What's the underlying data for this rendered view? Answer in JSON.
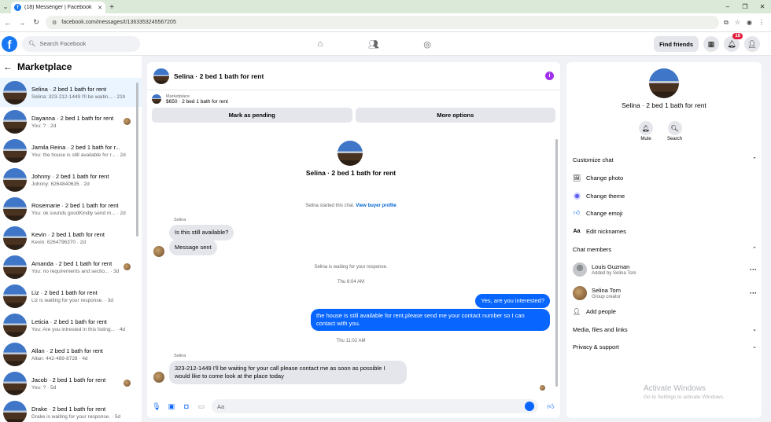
{
  "browser": {
    "tab_title": "(18) Messenger | Facebook",
    "url": "facebook.com/messages/t/1363353245567205"
  },
  "fb": {
    "search_placeholder": "Search Facebook",
    "find_friends": "Find friends",
    "notifications_badge": "18"
  },
  "sidebar": {
    "title": "Marketplace",
    "conversations": [
      {
        "title": "Selina · 2 bed 1 bath for rent",
        "sub": "Selina: 323-212-1449 I'll be waitin... · 21h",
        "active": true
      },
      {
        "title": "Dayanna · 2 bed 1 bath for rent",
        "sub": "You: ? · 2d"
      },
      {
        "title": "Jamila Reina · 2 bed 1 bath for r...",
        "sub": "You: the house is still available for r... · 2d"
      },
      {
        "title": "Johnny · 2 bed 1 bath for rent",
        "sub": "Johnny: 6264840635 · 2d"
      },
      {
        "title": "Rosemarie · 2 bed 1 bath for rent",
        "sub": "You: ok sounds goodKindly send m... · 2d"
      },
      {
        "title": "Kevin · 2 bed 1 bath for rent",
        "sub": "Kevin: 6264796370 · 2d"
      },
      {
        "title": "Amanda · 2 bed 1 bath for rent",
        "sub": "You: no requirements and sectio... · 3d"
      },
      {
        "title": "Liz · 2 bed 1 bath for rent",
        "sub": "Liz is waiting for your response. · 3d"
      },
      {
        "title": "Leticia · 2 bed 1 bath for rent",
        "sub": "You: Are you intrested in this listing... · 4d"
      },
      {
        "title": "Allan · 2 bed 1 bath for rent",
        "sub": "Allan: 442-489-8728 · 4d"
      },
      {
        "title": "Jacob · 2 bed 1 bath for rent",
        "sub": "You: ? · 5d"
      },
      {
        "title": "Drake · 2 bed 1 bath for rent",
        "sub": "Drake is waiting for your response. · 5d"
      }
    ]
  },
  "chat": {
    "title": "Selina · 2 bed 1 bath for rent",
    "marketplace_label": "Marketplace",
    "listing": "$650 · 2 bed 1 bath for rent",
    "mark_pending": "Mark as pending",
    "more_options": "More options",
    "center_name": "Selina · 2 bed 1 bath for rent",
    "started_text": "Selina started this chat.",
    "buyer_profile": "View buyer profile",
    "sender_name": "Selina",
    "msg1": "Is this still available?",
    "msg2": "Message sent",
    "waiting": "Selina is waiting for your response.",
    "time1": "Thu 6:04 AM",
    "out1": "Yes, are you interested?",
    "out2": "the house is still available for rent,please send me your contact number so I can contact with you.",
    "time2": "Thu 11:02 AM",
    "sender_name2": "Selina",
    "msg3": "323-212-1449 I'll be waiting for your call please contact me as soon as possible I would like to come look at the place today",
    "composer_placeholder": "Aa"
  },
  "rpanel": {
    "name": "Selina · 2 bed 1 bath for rent",
    "mute": "Mute",
    "search": "Search",
    "customize": "Customize chat",
    "change_photo": "Change photo",
    "change_theme": "Change theme",
    "change_emoji": "Change emoji",
    "edit_nicknames": "Edit nicknames",
    "chat_members": "Chat members",
    "members": [
      {
        "name": "Louis Guzman",
        "sub": "Added by Selina Tom"
      },
      {
        "name": "Selina Tom",
        "sub": "Group creator"
      }
    ],
    "add_people": "Add people",
    "media": "Media, files and links",
    "privacy": "Privacy & support"
  },
  "watermark": {
    "line1": "Activate Windows",
    "line2": "Go to Settings to activate Windows."
  },
  "colors": {
    "accent": "#0866ff",
    "fb_blue": "#1877f2",
    "info_purple": "#a12ee8"
  }
}
